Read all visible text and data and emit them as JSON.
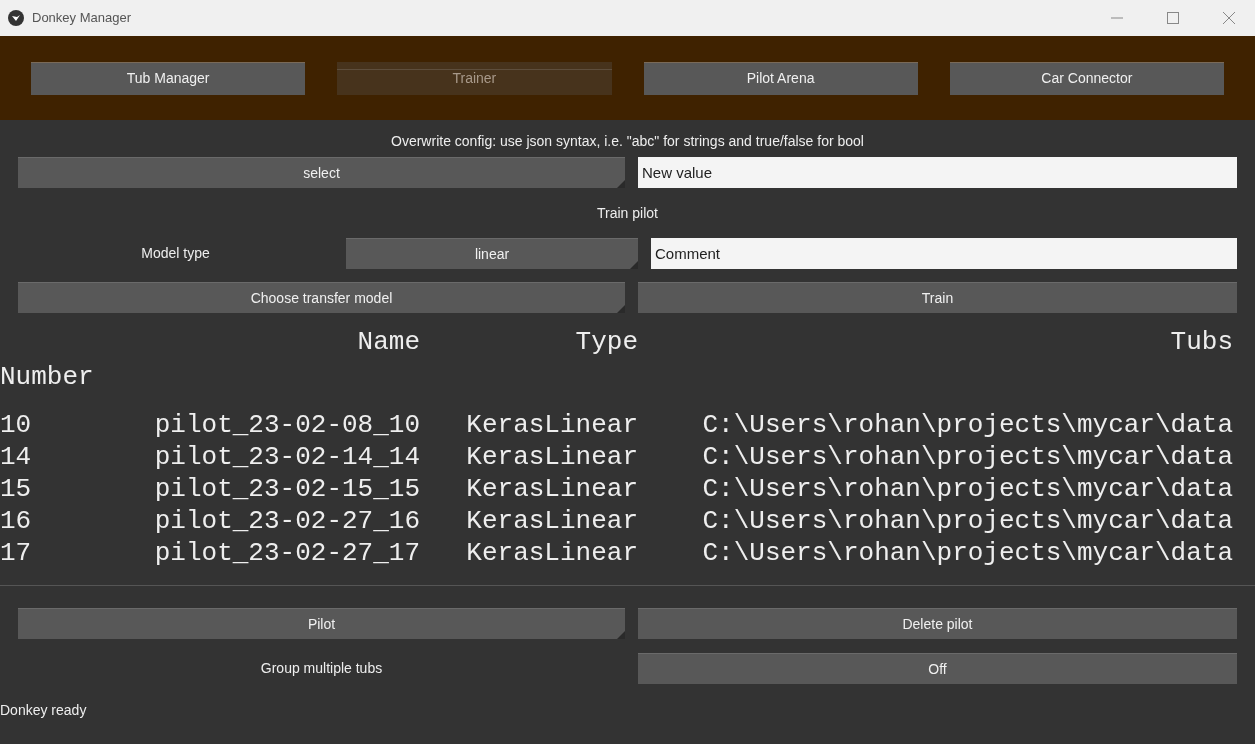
{
  "window": {
    "title": "Donkey Manager"
  },
  "tabs": [
    {
      "label": "Tub Manager",
      "selected": false
    },
    {
      "label": "Trainer",
      "selected": true
    },
    {
      "label": "Pilot Arena",
      "selected": false
    },
    {
      "label": "Car Connector",
      "selected": false
    }
  ],
  "config": {
    "hint": "Overwrite config: use json syntax, i.e. \"abc\" for strings and true/false for bool",
    "select_button": "select",
    "value_field": {
      "placeholder": "New value"
    }
  },
  "train": {
    "title": "Train pilot",
    "model_type_label": "Model type",
    "model_type_button": "linear",
    "comment_field": {
      "placeholder": "Comment"
    },
    "transfer_button": "Choose transfer model",
    "train_button": "Train"
  },
  "table": {
    "columns": [
      "Name",
      "Type",
      "Tubs"
    ],
    "number_header": "Number",
    "rows": [
      {
        "number": "10",
        "name": "pilot_23-02-08_10",
        "type": "KerasLinear",
        "tubs": "C:\\Users\\rohan\\projects\\mycar\\data"
      },
      {
        "number": "14",
        "name": "pilot_23-02-14_14",
        "type": "KerasLinear",
        "tubs": "C:\\Users\\rohan\\projects\\mycar\\data"
      },
      {
        "number": "15",
        "name": "pilot_23-02-15_15",
        "type": "KerasLinear",
        "tubs": "C:\\Users\\rohan\\projects\\mycar\\data"
      },
      {
        "number": "16",
        "name": "pilot_23-02-27_16",
        "type": "KerasLinear",
        "tubs": "C:\\Users\\rohan\\projects\\mycar\\data"
      },
      {
        "number": "17",
        "name": "pilot_23-02-27_17",
        "type": "KerasLinear",
        "tubs": "C:\\Users\\rohan\\projects\\mycar\\data"
      }
    ]
  },
  "pilot_button": "Pilot",
  "delete_button": "Delete pilot",
  "group": {
    "label": "Group multiple tubs",
    "toggle": "Off"
  },
  "status_bar": "Donkey ready"
}
